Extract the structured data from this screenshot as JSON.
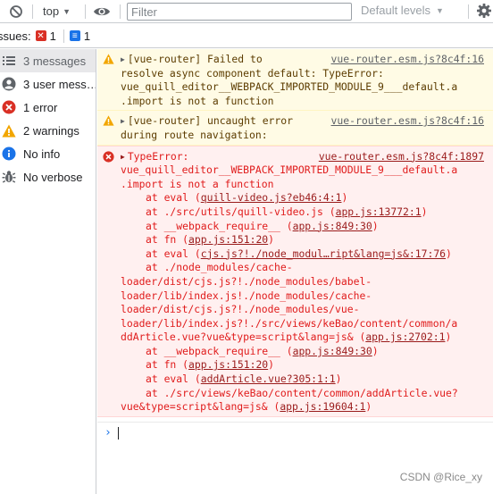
{
  "toolbar": {
    "context": "top",
    "filter_placeholder": "Filter",
    "levels_label": "Default levels"
  },
  "issues": {
    "label": "ssues:",
    "error_count": "1",
    "info_count": "1"
  },
  "sidebar": {
    "items": [
      {
        "label": "3 messages",
        "icon": "list-icon"
      },
      {
        "label": "3 user mess…",
        "icon": "user-icon"
      },
      {
        "label": "1 error",
        "icon": "error-icon"
      },
      {
        "label": "2 warnings",
        "icon": "warning-icon"
      },
      {
        "label": "No info",
        "icon": "info-icon"
      },
      {
        "label": "No verbose",
        "icon": "bug-icon"
      }
    ]
  },
  "console": {
    "warn1": {
      "source": "vue-router.esm.js?8c4f:16",
      "lines": [
        "[vue-router] Failed to",
        "resolve async component default: TypeError:",
        "vue_quill_editor__WEBPACK_IMPORTED_MODULE_9___default.a",
        ".import is not a function"
      ]
    },
    "warn2": {
      "source": "vue-router.esm.js?8c4f:16",
      "lines": [
        "[vue-router] uncaught error",
        "during route navigation:"
      ]
    },
    "error": {
      "source": "vue-router.esm.js?8c4f:1897",
      "head": "TypeError:",
      "lines": [
        "vue_quill_editor__WEBPACK_IMPORTED_MODULE_9___default.a",
        ".import is not a function"
      ],
      "stack": [
        {
          "pre": "at eval (",
          "link": "quill-video.js?eb46:4:1",
          "post": ")",
          "indent": true
        },
        {
          "pre": "at ./src/utils/quill-video.js (",
          "link": "app.js:13772:1",
          "post": ")",
          "indent": true
        },
        {
          "pre": "at __webpack_require__ (",
          "link": "app.js:849:30",
          "post": ")",
          "indent": true
        },
        {
          "pre": "at fn (",
          "link": "app.js:151:20",
          "post": ")",
          "indent": true
        },
        {
          "pre": "at eval (",
          "link": "cjs.js?!./node_modul…ript&lang=js&:17:76",
          "post": ")",
          "indent": true
        },
        {
          "pre": "at ./node_modules/cache-",
          "link": "",
          "post": "",
          "indent": true
        },
        {
          "pre": "loader/dist/cjs.js?!./node_modules/babel-",
          "link": "",
          "post": "",
          "indent": false
        },
        {
          "pre": "loader/lib/index.js!./node_modules/cache-",
          "link": "",
          "post": "",
          "indent": false
        },
        {
          "pre": "loader/dist/cjs.js?!./node_modules/vue-",
          "link": "",
          "post": "",
          "indent": false
        },
        {
          "pre": "loader/lib/index.js?!./src/views/keBao/content/common/a",
          "link": "",
          "post": "",
          "indent": false
        },
        {
          "pre": "ddArticle.vue?vue&type=script&lang=js& (",
          "link": "app.js:2702:1",
          "post": ")",
          "indent": false
        },
        {
          "pre": "at __webpack_require__ (",
          "link": "app.js:849:30",
          "post": ")",
          "indent": true
        },
        {
          "pre": "at fn (",
          "link": "app.js:151:20",
          "post": ")",
          "indent": true
        },
        {
          "pre": "at eval (",
          "link": "addArticle.vue?305:1:1",
          "post": ")",
          "indent": true
        },
        {
          "pre": "at ./src/views/keBao/content/common/addArticle.vue?",
          "link": "",
          "post": "",
          "indent": true
        },
        {
          "pre": "vue&type=script&lang=js& (",
          "link": "app.js:19604:1",
          "post": ")",
          "indent": false
        }
      ]
    },
    "prompt_symbol": "›"
  },
  "watermark": "CSDN @Rice_xy"
}
